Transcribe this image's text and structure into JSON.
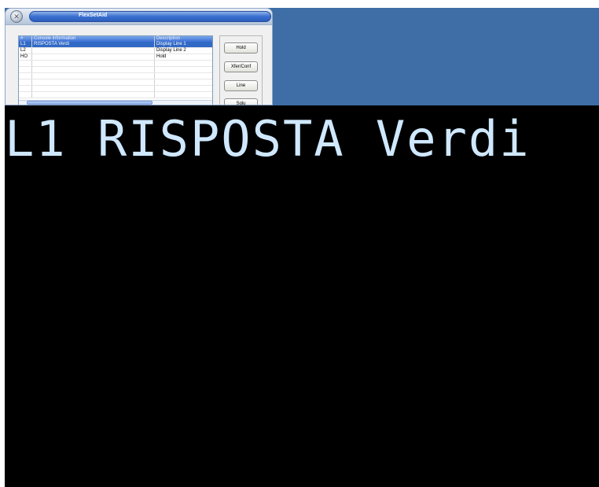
{
  "window": {
    "title": "FlexSetAid",
    "system_icon": "close-circle-icon"
  },
  "list": {
    "columns": [
      "#",
      "Console information",
      "Description"
    ],
    "rows": [
      {
        "id": "L1",
        "info": "RISPOSTA Verdi",
        "desc": "Display Line 1",
        "selected": true
      },
      {
        "id": "L2",
        "info": "",
        "desc": "Display Line 2",
        "selected": false
      },
      {
        "id": "HO",
        "info": "",
        "desc": "Hold",
        "selected": false
      }
    ]
  },
  "buttons": {
    "hold": "Hold",
    "xfer_conf": "Xfer/Conf",
    "line": "Line",
    "sglu": "Sglu"
  },
  "display": {
    "text": "L1 RISPOSTA Verdi"
  },
  "colors": {
    "desktop": "#3e6ea5",
    "display_bg": "#000000",
    "display_text": "#cfe8ff",
    "selection": "#316ac5"
  }
}
